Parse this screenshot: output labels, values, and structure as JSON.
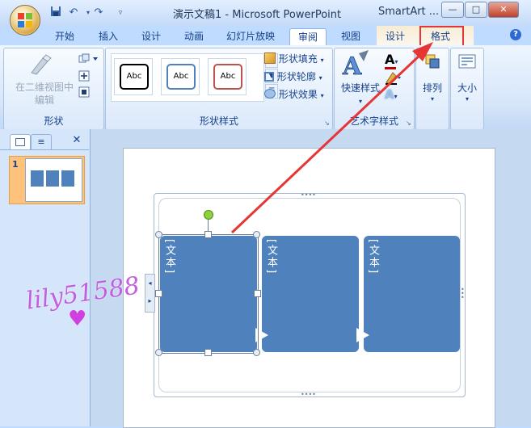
{
  "window": {
    "title": "演示文稿1 - Microsoft PowerPoint",
    "context_title": "SmartArt ..."
  },
  "qat_icons": [
    "save-icon",
    "undo-icon",
    "redo-icon",
    "customize-qat-icon"
  ],
  "tabs": [
    {
      "label": "开始"
    },
    {
      "label": "插入"
    },
    {
      "label": "设计"
    },
    {
      "label": "动画"
    },
    {
      "label": "幻灯片放映"
    },
    {
      "label": "审阅"
    },
    {
      "label": "视图"
    },
    {
      "label": "设计"
    },
    {
      "label": "格式"
    }
  ],
  "ribbon": {
    "shapes_group": {
      "label": "形状",
      "edit_2d_line1": "在二维视图中",
      "edit_2d_line2": "编辑"
    },
    "shape_styles_group": {
      "label": "形状样式",
      "thumb_text": "Abc",
      "fill": "形状填充",
      "outline": "形状轮廓",
      "effects": "形状效果"
    },
    "wordart_group": {
      "label": "艺术字样式",
      "quick_styles": "快速样式"
    },
    "arrange": {
      "label": "排列"
    },
    "size": {
      "label": "大小"
    }
  },
  "slides_pane": {
    "slide_number": "1"
  },
  "smartart": {
    "boxes": [
      "[文本]",
      "[文本]",
      "[文本]"
    ],
    "fill_color": "#4f81bd"
  },
  "watermark": "lily51588",
  "annotation_color": "#e53535"
}
